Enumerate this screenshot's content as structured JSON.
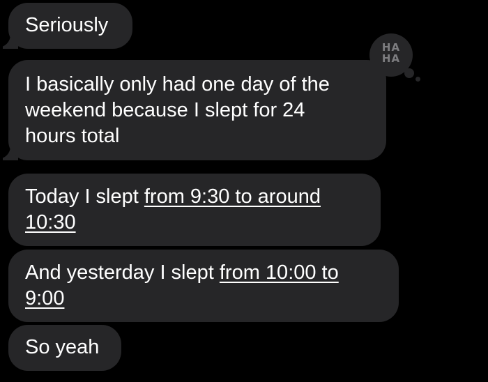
{
  "messages": [
    {
      "parts": [
        "Seriously"
      ]
    },
    {
      "parts": [
        "I basically only had one day of the",
        "weekend because I slept for 24",
        "hours total"
      ]
    },
    {
      "line1": "Today I slept ",
      "line1_link": "from 9:30 to around",
      "line2_link": "10:30"
    },
    {
      "line1": "And yesterday I slept ",
      "line1_link": "from 10:00 to",
      "line2_link": "9:00"
    },
    {
      "parts": [
        "So yeah"
      ]
    }
  ],
  "reaction": {
    "type": "haha",
    "line1": "HA",
    "line2": "HA"
  },
  "colors": {
    "background": "#000000",
    "bubble": "#262628",
    "text": "#ffffff",
    "reaction_text": "#7d7d80"
  }
}
